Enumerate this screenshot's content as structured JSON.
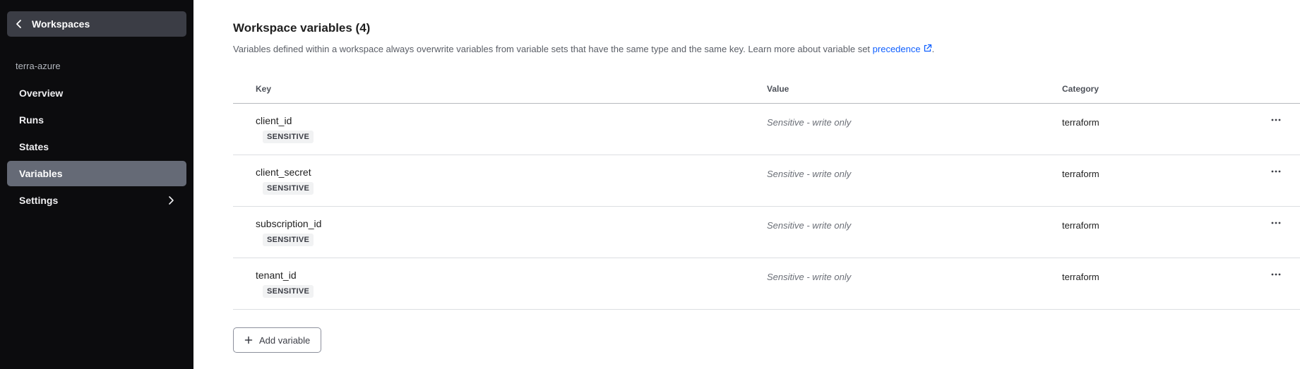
{
  "sidebar": {
    "back_label": "Workspaces",
    "org_name": "terra-azure",
    "items": [
      {
        "label": "Overview",
        "active": false
      },
      {
        "label": "Runs",
        "active": false
      },
      {
        "label": "States",
        "active": false
      },
      {
        "label": "Variables",
        "active": true
      },
      {
        "label": "Settings",
        "active": false,
        "has_submenu": true
      }
    ]
  },
  "main": {
    "title": "Workspace variables (4)",
    "description_prefix": "Variables defined within a workspace always overwrite variables from variable sets that have the same type and the same key. Learn more about variable set ",
    "description_link": "precedence",
    "description_suffix": ".",
    "table": {
      "headers": {
        "key": "Key",
        "value": "Value",
        "category": "Category"
      },
      "rows": [
        {
          "key": "client_id",
          "badge": "SENSITIVE",
          "value": "Sensitive - write only",
          "category": "terraform"
        },
        {
          "key": "client_secret",
          "badge": "SENSITIVE",
          "value": "Sensitive - write only",
          "category": "terraform"
        },
        {
          "key": "subscription_id",
          "badge": "SENSITIVE",
          "value": "Sensitive - write only",
          "category": "terraform"
        },
        {
          "key": "tenant_id",
          "badge": "SENSITIVE",
          "value": "Sensitive - write only",
          "category": "terraform"
        }
      ]
    },
    "add_button_label": "Add variable"
  },
  "icons": {
    "back": "chevron-left-icon",
    "submenu": "chevron-right-icon",
    "external": "external-link-icon",
    "more": "more-horizontal-icon",
    "add": "plus-icon"
  },
  "colors": {
    "sidebar_bg": "#0c0c0e",
    "active_nav_bg": "#656a76",
    "link": "#1060ff"
  }
}
